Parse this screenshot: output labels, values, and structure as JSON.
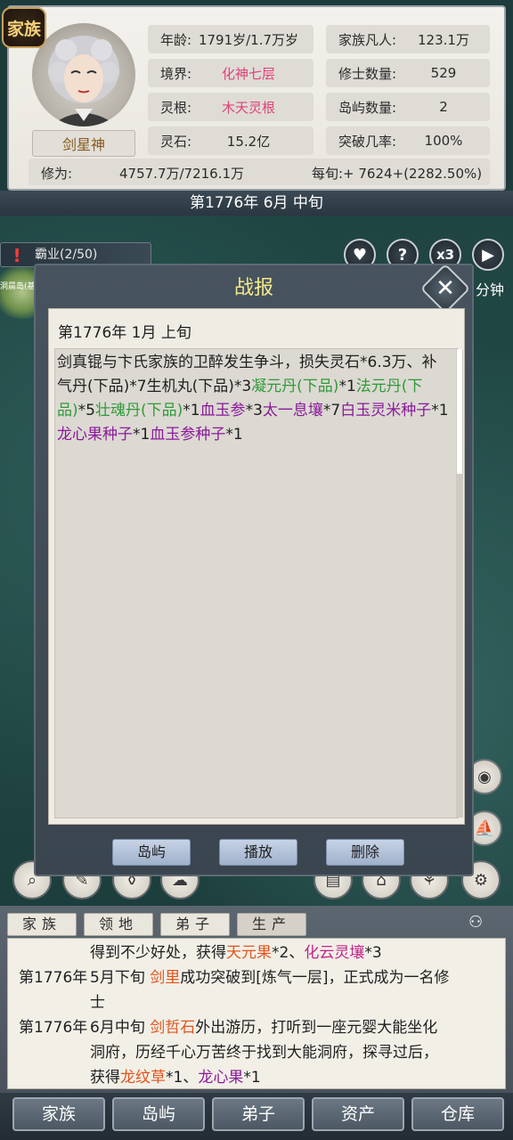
{
  "clan_badge": "家族",
  "character_name": "剑星神",
  "stats": {
    "age_label": "年龄:",
    "age_value": "1791岁/1.7万岁",
    "realm_label": "境界:",
    "realm_value": "化神七层",
    "root_label": "灵根:",
    "root_value": "木天灵根",
    "stone_label": "灵石:",
    "stone_value": "15.2亿",
    "family_label": "家族凡人:",
    "family_value": "123.1万",
    "cultivator_label": "修士数量:",
    "cultivator_value": "529",
    "island_label": "岛屿数量:",
    "island_value": "2",
    "breakthrough_label": "突破几率:",
    "breakthrough_value": "100%"
  },
  "cultivation": {
    "label": "修为:",
    "value": "4757.7万/7216.1万",
    "rate": "每旬:+ 7624+(2282.50%)"
  },
  "current_date": "第1776年 6月 中旬",
  "dominion": "霸业(2/50)",
  "island_tag": "洞晨岛(基)",
  "map_right_text": "分钟",
  "speed_label": "x3",
  "modal": {
    "title": "战报",
    "report_date": "第1776年 1月 上旬",
    "report_parts": [
      {
        "t": "剑真锟与卞氏家族的卫醉发生争斗，损失灵石*6.3万、补气丹(下品)*7生机丸(下品)*3",
        "c": ""
      },
      {
        "t": "凝元丹(下品)",
        "c": "g"
      },
      {
        "t": "*1",
        "c": ""
      },
      {
        "t": "法元丹(下品)",
        "c": "g"
      },
      {
        "t": "*5",
        "c": ""
      },
      {
        "t": "壮魂丹(下品)",
        "c": "g"
      },
      {
        "t": "*1",
        "c": ""
      },
      {
        "t": "血玉参",
        "c": "p"
      },
      {
        "t": "*3",
        "c": ""
      },
      {
        "t": "太一息壤",
        "c": "p"
      },
      {
        "t": "*7",
        "c": ""
      },
      {
        "t": "白玉灵米种子",
        "c": "p"
      },
      {
        "t": "*1",
        "c": ""
      },
      {
        "t": "龙心果种子",
        "c": "p"
      },
      {
        "t": "*1",
        "c": ""
      },
      {
        "t": "血玉参种子",
        "c": "p"
      },
      {
        "t": "*1",
        "c": ""
      }
    ],
    "buttons": [
      "岛屿",
      "播放",
      "删除"
    ]
  },
  "log_tabs": [
    "家族",
    "领地",
    "弟子",
    "生产"
  ],
  "log": {
    "line1_a": "得到不少好处，获得",
    "line1_b": "天元果",
    "line1_c": "*2、",
    "line1_d": "化云灵壤",
    "line1_e": "*3",
    "line2_date": "第1776年",
    "line2_a": "5月下旬 ",
    "line2_b": "剑里",
    "line2_c": "成功突破到[炼气一层]，正式成为一名修",
    "line3": "士",
    "line4_date": "第1776年",
    "line4_a": "6月中旬 ",
    "line4_b": "剑哲石",
    "line4_c": "外出游历，打听到一座元婴大能坐化",
    "line5": "洞府，历经千心万苦终于找到大能洞府，探寻过后，",
    "line6_a": "获得",
    "line6_b": "龙纹草",
    "line6_c": "*1、",
    "line6_d": "龙心果",
    "line6_e": "*1"
  },
  "nav": [
    "家族",
    "岛屿",
    "弟子",
    "资产",
    "仓库"
  ]
}
